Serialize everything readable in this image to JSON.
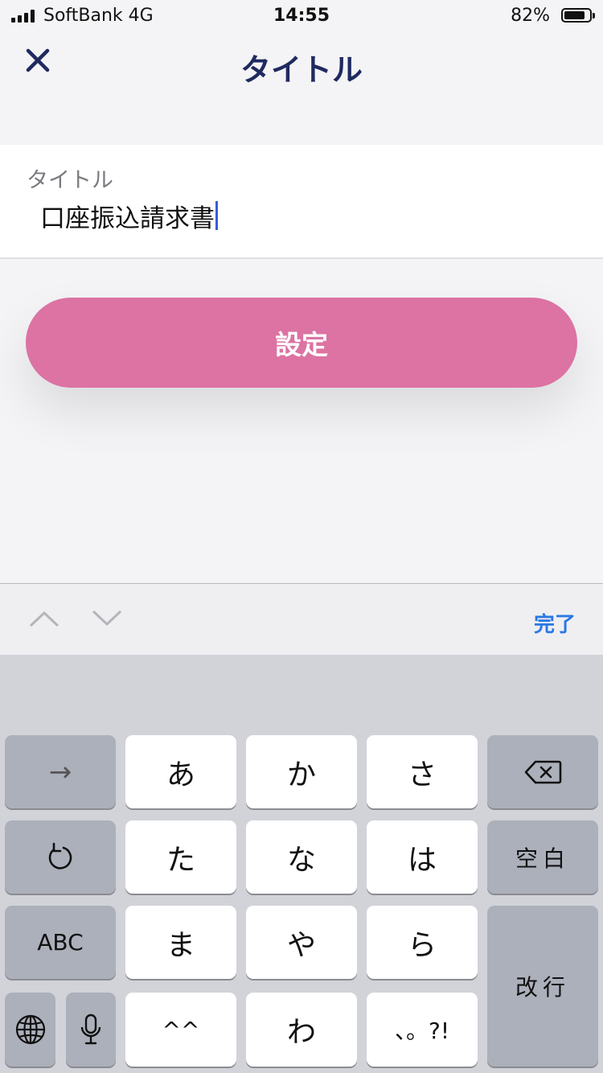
{
  "status_bar": {
    "carrier": "SoftBank   4G",
    "time": "14:55",
    "battery_percent": "82%",
    "battery_level": 0.82
  },
  "nav": {
    "title": "タイトル",
    "close_icon": "close-icon"
  },
  "field": {
    "label": "タイトル",
    "value": "口座振込請求書"
  },
  "set_button": {
    "label": "設定"
  },
  "accessory": {
    "prev_icon": "chevron-up-icon",
    "next_icon": "chevron-down-icon",
    "done_label": "完了"
  },
  "keyboard": {
    "row1": [
      "→",
      "あ",
      "か",
      "さ"
    ],
    "row2": [
      "た",
      "な",
      "は"
    ],
    "space_label": "空白",
    "abc_label": "ABC",
    "row3": [
      "ま",
      "や",
      "ら"
    ],
    "return_label": "改行",
    "row4": [
      "^^",
      "わ",
      "、。?!"
    ],
    "icons": [
      "undo-icon",
      "delete-icon",
      "globe-icon",
      "microphone-icon"
    ]
  },
  "colors": {
    "accent_pink": "#dc73a3",
    "title_navy": "#1f2a60",
    "done_blue": "#2a78e4",
    "caret_blue": "#3a5bd9"
  }
}
